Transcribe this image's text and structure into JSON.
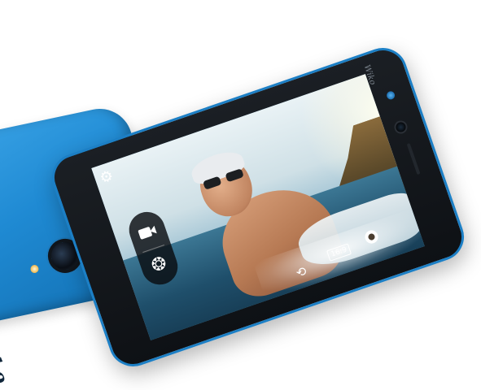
{
  "back_phone": {
    "brand": "Wiko",
    "color": "#1f8ad3"
  },
  "front_phone": {
    "brand": "Wiko",
    "bezel_color": "#101317",
    "accent_color": "#1c7fc5"
  },
  "camera_ui": {
    "settings_icon": "gear-icon",
    "video_icon": "video-camera-icon",
    "shutter_icon": "aperture-icon",
    "switch_camera_icon": "switch-camera-icon",
    "aspect_label": "16:9",
    "filter_icon": "filter-icon"
  }
}
